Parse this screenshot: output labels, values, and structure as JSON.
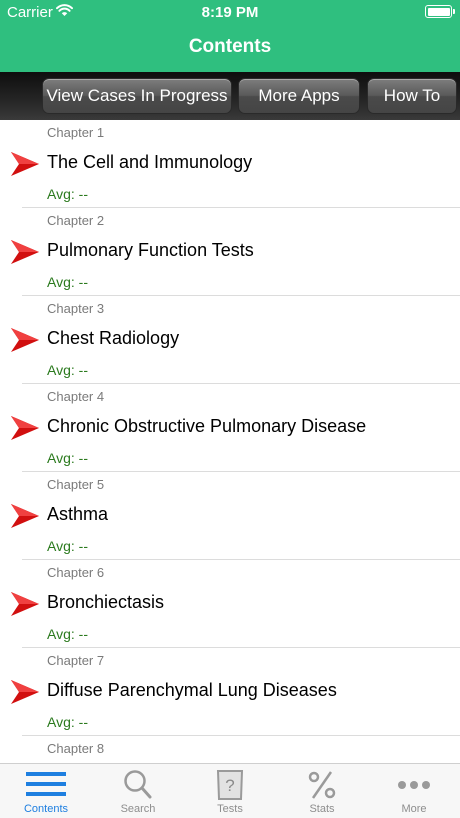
{
  "status_bar": {
    "carrier": "Carrier",
    "time": "8:19 PM"
  },
  "nav": {
    "title": "Contents"
  },
  "toolbar": {
    "view_cases": "View Cases In Progress",
    "more_apps": "More Apps",
    "how_to": "How To"
  },
  "chapters": [
    {
      "number": "Chapter 1",
      "title": "The Cell and Immunology",
      "avg": "Avg: --"
    },
    {
      "number": "Chapter 2",
      "title": "Pulmonary Function Tests",
      "avg": "Avg: --"
    },
    {
      "number": "Chapter 3",
      "title": "Chest Radiology",
      "avg": "Avg: --"
    },
    {
      "number": "Chapter 4",
      "title": "Chronic Obstructive Pulmonary Disease",
      "avg": "Avg: --"
    },
    {
      "number": "Chapter 5",
      "title": "Asthma",
      "avg": "Avg: --"
    },
    {
      "number": "Chapter 6",
      "title": "Bronchiectasis",
      "avg": "Avg: --"
    },
    {
      "number": "Chapter 7",
      "title": "Diffuse Parenchymal Lung Diseases",
      "avg": "Avg: --"
    },
    {
      "number": "Chapter 8",
      "title": "",
      "avg": ""
    }
  ],
  "tabs": [
    {
      "label": "Contents",
      "icon": "list-icon"
    },
    {
      "label": "Search",
      "icon": "magnifier-icon"
    },
    {
      "label": "Tests",
      "icon": "question-paper-icon"
    },
    {
      "label": "Stats",
      "icon": "percent-icon"
    },
    {
      "label": "More",
      "icon": "ellipsis-icon"
    }
  ],
  "colors": {
    "accent": "#2fbf7f",
    "tab_active": "#1e7fe0",
    "avg_green": "#2b7a1e",
    "arrow_red": "#d10f0f"
  }
}
